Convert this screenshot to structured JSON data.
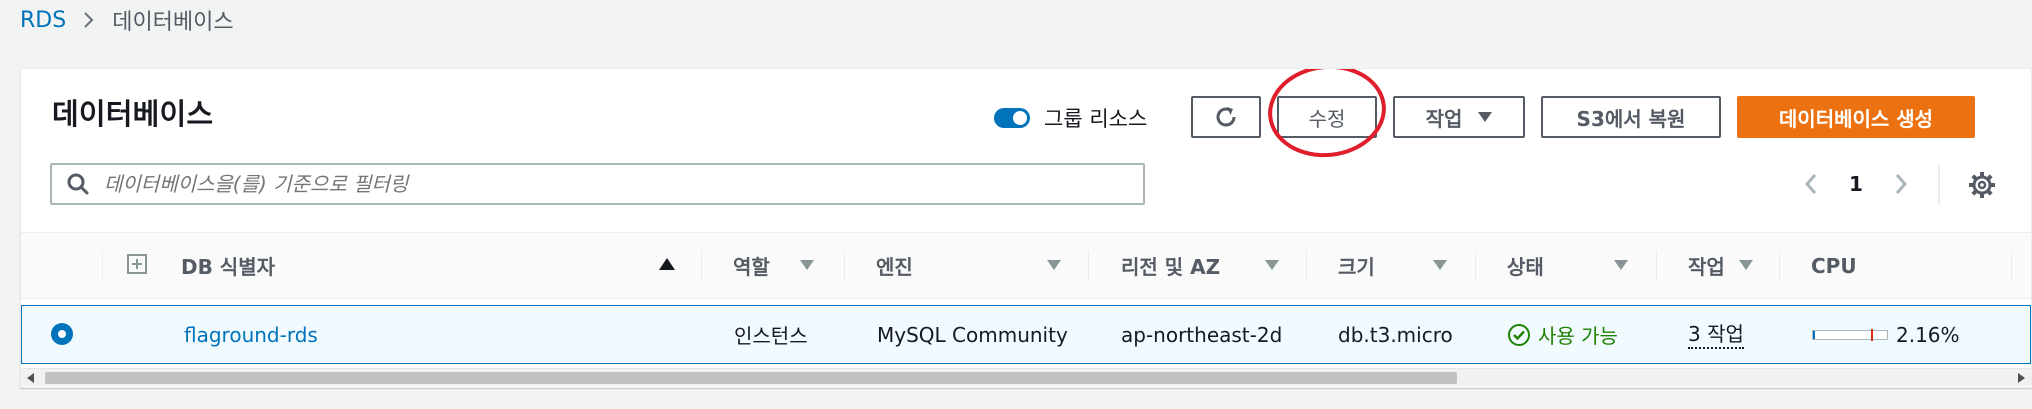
{
  "breadcrumb": {
    "root": "RDS",
    "separator_icon": "chevron-right-icon",
    "current": "데이터베이스"
  },
  "panel": {
    "title": "데이터베이스",
    "toggle": {
      "label": "그룹 리소스",
      "on": true
    },
    "buttons": {
      "refresh_icon": "refresh-icon",
      "modify": "수정",
      "actions": "작업",
      "restore": "S3에서 복원",
      "create": "데이터베이스 생성"
    },
    "search": {
      "placeholder": "데이터베이스을(를) 기준으로 필터링",
      "value": ""
    },
    "pagination": {
      "page": "1"
    }
  },
  "table": {
    "columns": {
      "db_id": "DB 식별자",
      "role": "역할",
      "engine": "엔진",
      "region_az": "리전 및 AZ",
      "size": "크기",
      "status": "상태",
      "actions": "작업",
      "cpu": "CPU"
    },
    "row": {
      "selected": true,
      "db_id": "flaground-rds",
      "role": "인스턴스",
      "engine": "MySQL Community",
      "region_az": "ap-northeast-2d",
      "size": "db.t3.micro",
      "status": "사용 가능",
      "actions": "3 작업",
      "cpu_value": "2.16%",
      "cpu_fraction": 0.0216
    }
  },
  "colors": {
    "accent": "#0073bb",
    "primary_button": "#ec7211",
    "status_ok": "#1d8102",
    "annotation": "#e01d2a"
  }
}
